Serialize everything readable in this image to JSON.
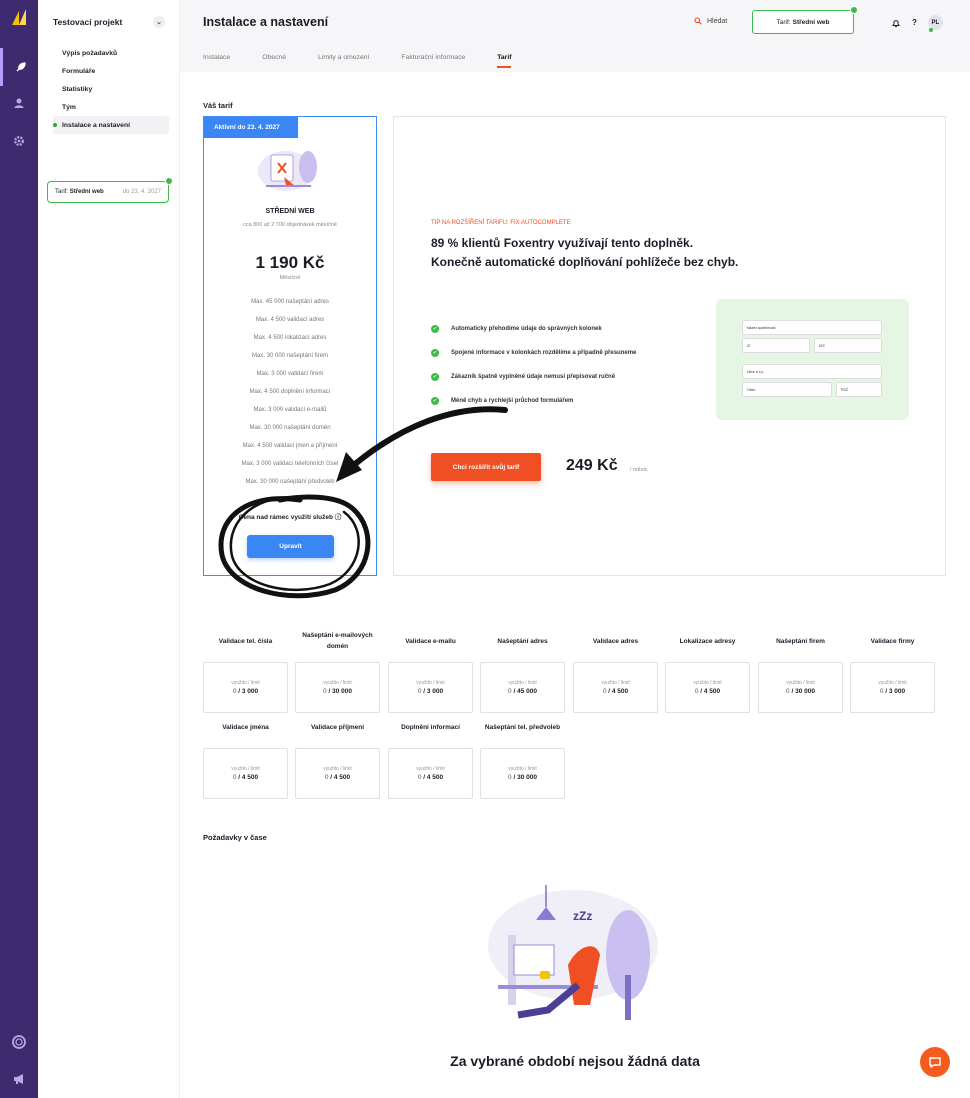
{
  "sidebar": {
    "project": "Testovací projekt",
    "items": [
      {
        "label": "Výpis požadavků"
      },
      {
        "label": "Formuláře"
      },
      {
        "label": "Statistiky"
      },
      {
        "label": "Tým"
      },
      {
        "label": "Instalace a nastavení"
      }
    ],
    "tarif_label": "Tarif:",
    "tarif_name": "Střední web",
    "tarif_date": "do 23. 4. 2027"
  },
  "header": {
    "title": "Instalace a nastavení",
    "search_label": "Hledat",
    "tarif_label": "Tarif:",
    "tarif_name": "Střední web",
    "help": "?",
    "avatar": "PL"
  },
  "tabs": [
    {
      "label": "Instalace"
    },
    {
      "label": "Obecné"
    },
    {
      "label": "Limity a omezení"
    },
    {
      "label": "Fakturační informace"
    },
    {
      "label": "Tarif"
    }
  ],
  "plan": {
    "section_title": "Váš tarif",
    "active_badge": "Aktivní do 23. 4. 2027",
    "name": "STŘEDNÍ WEB",
    "description": "cca 800 až 2 700 objednávek měsíčně",
    "price": "1 190 Kč",
    "period": "Měsíčně",
    "features": [
      "Max. 45 000 našeptání adres",
      "Max. 4 500 validací adres",
      "Max. 4 500 lokalizací adres",
      "Max. 30 000 našeptání firem",
      "Max. 3 000 validací firem",
      "Max. 4 500 doplnění informací",
      "Max. 3 000 validací e-mailů",
      "Max. 30 000 našeptání domén",
      "Max. 4 500 validací jmen a příjmení",
      "Max. 3 000 validací telefonních čísel",
      "Max. 30 000 našeptání předvoleb"
    ],
    "overage": "Cena nad rámec využití služeb",
    "edit_button": "Upravit"
  },
  "promo": {
    "tip": "TIP NA ROZŠÍŘENÍ TARIFU: FIX AUTOCOMPLETE",
    "headline_1": "89 % klientů Foxentry využívají tento doplněk.",
    "headline_2": "Konečně automatické doplňování pohlížeče bez chyb.",
    "features": [
      "Automaticky přehodíme údaje do správných kolonek",
      "Spojené informace v kolonkách rozdělíme a případně přesuneme",
      "Zákazník špatně vyplněné údaje nemusí přepisovat ručně",
      "Méně chyb a rychlejší průchod formulářem"
    ],
    "form_fields": [
      "Název společnosti",
      "IČ",
      "DIČ",
      "Ulice a č.p.",
      "Obec",
      "PSČ"
    ],
    "cta": "Chci rozšířit svůj tarif",
    "price": "249 Kč",
    "period": "/ měsíc"
  },
  "usage": {
    "used_limit_label": "využito / limit",
    "items": [
      {
        "label": "Validace tel. čísla",
        "used": "0",
        "limit": "/ 3 000"
      },
      {
        "label": "Našeptání e-mailových domén",
        "used": "0",
        "limit": "/ 30 000"
      },
      {
        "label": "Validace e-mailu",
        "used": "0",
        "limit": "/ 3 000"
      },
      {
        "label": "Našeptání adres",
        "used": "0",
        "limit": "/ 45 000"
      },
      {
        "label": "Validace adres",
        "used": "0",
        "limit": "/ 4 500"
      },
      {
        "label": "Lokalizace adresy",
        "used": "0",
        "limit": "/ 4 500"
      },
      {
        "label": "Našeptání firem",
        "used": "0",
        "limit": "/ 30 000"
      },
      {
        "label": "Validace firmy",
        "used": "0",
        "limit": "/ 3 000"
      },
      {
        "label": "Validace jména",
        "used": "0",
        "limit": "/ 4 500"
      },
      {
        "label": "Validace příjmení",
        "used": "0",
        "limit": "/ 4 500"
      },
      {
        "label": "Doplnění informací",
        "used": "0",
        "limit": "/ 4 500"
      },
      {
        "label": "Našeptání tel. předvoleb",
        "used": "0",
        "limit": "/ 30 000"
      }
    ]
  },
  "requests": {
    "title": "Požadavky v čase",
    "empty": "Za vybrané období nejsou žádná data"
  },
  "colors": {
    "rail": "#3e2a6e",
    "primary": "#3b86f5",
    "accent": "#f04e23",
    "success": "#3dbb47"
  }
}
